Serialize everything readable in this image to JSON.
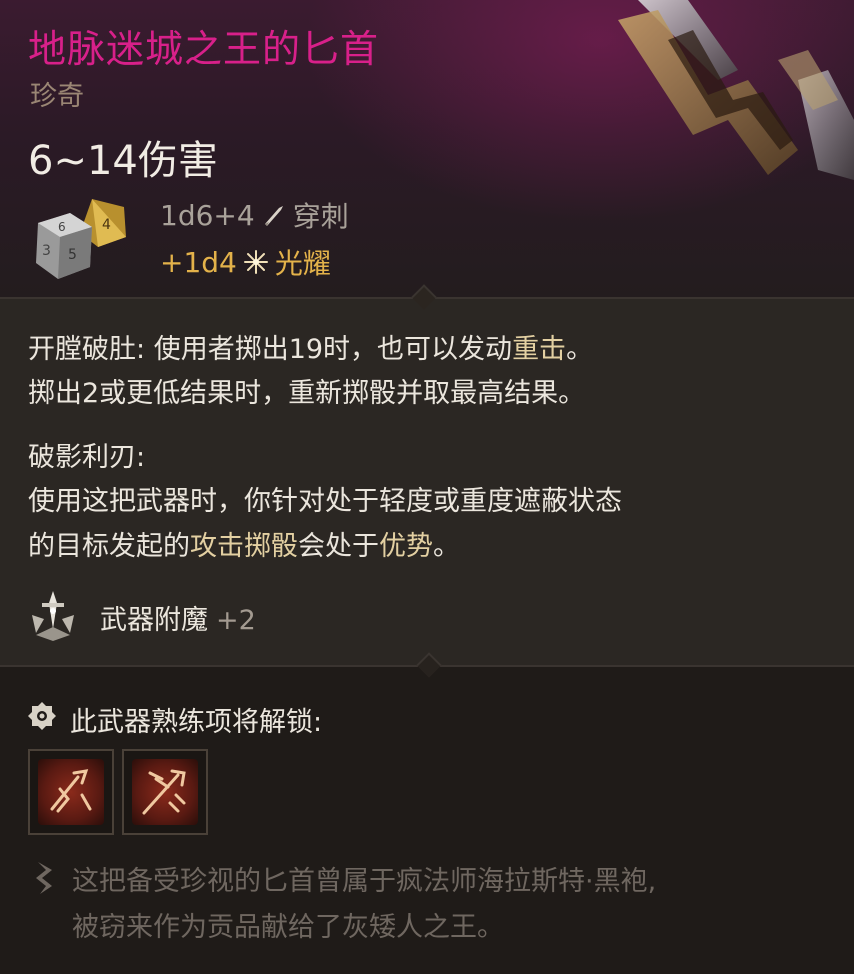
{
  "item": {
    "name": "地脉迷城之王的匕首",
    "rarity": "珍奇",
    "damage": "6~14伤害",
    "rarity_color": "#d8208a"
  },
  "damage_lines": [
    {
      "formula": "1d6+4",
      "icon": "piercing-icon",
      "type": "穿刺",
      "color": "#a9a29a"
    },
    {
      "formula": "+1d4",
      "icon": "radiant-icon",
      "type": "光耀",
      "color": "#e3b24a"
    }
  ],
  "properties": {
    "p1_line1_title": "开膛破肚:",
    "p1_line1_text": " 使用者掷出19时，也可以发动",
    "p1_line1_kw": "重击",
    "p1_line1_end": "。",
    "p1_line2": "掷出2或更低结果时，重新掷骰并取最高结果。",
    "p2_title": "破影利刃:",
    "p2_line1": "使用这把武器时，你针对处于轻度或重度遮蔽状态",
    "p2_line2_a": "的目标发起的",
    "p2_line2_kw1": "攻击掷骰",
    "p2_line2_b": "会处于",
    "p2_line2_kw2": "优势",
    "p2_line2_end": "。"
  },
  "enchantment": {
    "label": "武器附魔",
    "bonus": "+2",
    "icon": "weapon-enchant-icon"
  },
  "proficiency": {
    "label": "此武器熟练项将解锁:",
    "icon": "unlock-icon",
    "skills": [
      {
        "icon": "piercing-strike-icon"
      },
      {
        "icon": "flourish-icon"
      }
    ]
  },
  "lore": {
    "line1": "这把备受珍视的匕首曾属于疯法师海拉斯特·黑袍,",
    "line2": "被窃来作为贡品献给了灰矮人之王。",
    "icon": "quill-icon"
  }
}
